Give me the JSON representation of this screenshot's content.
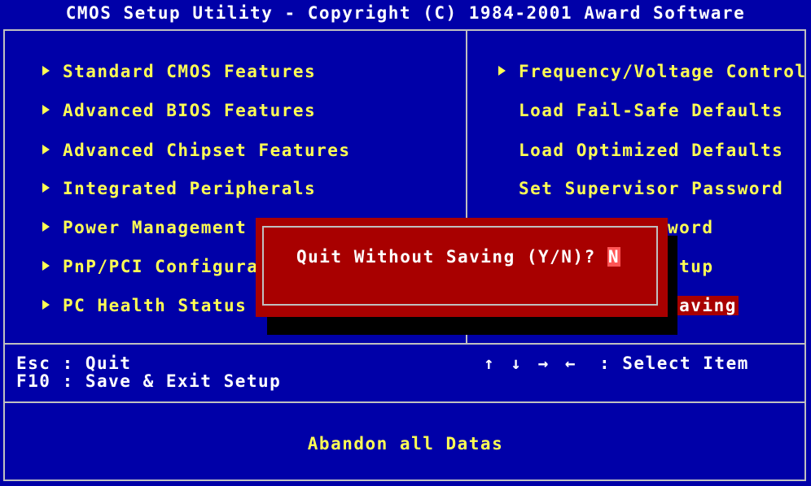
{
  "window": {
    "title": "CMOS Setup Utility - Copyright (C) 1984-2001 Award Software"
  },
  "menu_left": [
    {
      "label": "Standard CMOS Features",
      "submenu": true
    },
    {
      "label": "Advanced BIOS Features",
      "submenu": true
    },
    {
      "label": "Advanced Chipset Features",
      "submenu": true
    },
    {
      "label": "Integrated Peripherals",
      "submenu": true
    },
    {
      "label": "Power Management",
      "submenu": true
    },
    {
      "label": "PnP/PCI Configura",
      "submenu": true
    },
    {
      "label": "PC Health Status",
      "submenu": true
    }
  ],
  "menu_right": [
    {
      "label": "Frequency/Voltage Control",
      "submenu": true
    },
    {
      "label": "Load Fail-Safe Defaults",
      "submenu": false
    },
    {
      "label": "Load Optimized Defaults",
      "submenu": false
    },
    {
      "label": "Set Supervisor Password",
      "submenu": false
    },
    {
      "label": "word",
      "submenu": false
    },
    {
      "label": "etup",
      "submenu": false
    },
    {
      "label": "Saving",
      "submenu": false,
      "selected": true
    }
  ],
  "help": {
    "esc": "Esc : Quit",
    "f10": "F10 : Save & Exit Setup",
    "arrows": "↑ ↓ → ←",
    "select": ": Select Item"
  },
  "status": "Abandon all Datas",
  "dialog": {
    "prompt": "Quit Without Saving (Y/N)?",
    "value": "N"
  },
  "colors": {
    "background": "#0000a8",
    "item_text": "#ffff54",
    "dialog_bg": "#a80000",
    "border": "#c0c0c0"
  }
}
